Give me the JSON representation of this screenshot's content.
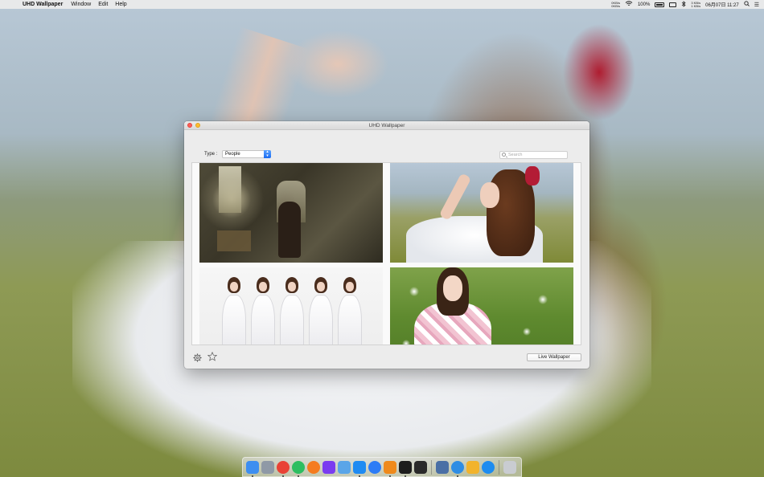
{
  "menubar": {
    "apple_symbol": "",
    "app_name": "UHD Wallpaper",
    "menus": [
      "Window",
      "Edit",
      "Help"
    ],
    "net_up": "0KB/s",
    "net_down": "0KB/s",
    "battery": "100%",
    "net_stat_up": "3 KB/s",
    "net_stat_down": "1 KB/s",
    "clock": "06月07日 11:27"
  },
  "window": {
    "title": "UHD Wallpaper",
    "type_label": "Type :",
    "type_value": "People",
    "search_placeholder": "Search",
    "live_wallpaper_label": "Live Wallpaper"
  },
  "gallery": {
    "thumbnails": [
      {
        "subject": "man-in-abandoned-room"
      },
      {
        "subject": "girl-with-red-bow-in-field"
      },
      {
        "subject": "group-in-white-dresses"
      },
      {
        "subject": "girl-in-kimono-with-flowers"
      }
    ]
  },
  "icons": {
    "settings": "gear-icon",
    "favorites": "star-icon",
    "search": "search-icon",
    "dropdown": "chevron-updown-icon"
  },
  "dock": {
    "apps": [
      {
        "name": "finder-icon",
        "color": "#3d8ef0"
      },
      {
        "name": "launchpad-icon",
        "color": "#8f99a6"
      },
      {
        "name": "chrome-icon",
        "color": "#e94235"
      },
      {
        "name": "evernote-icon",
        "color": "#2dbe60"
      },
      {
        "name": "books-icon",
        "color": "#f57c1f"
      },
      {
        "name": "istat-icon",
        "color": "#7a3cf0"
      },
      {
        "name": "preview-icon",
        "color": "#5aa5e8"
      },
      {
        "name": "xcode-icon",
        "color": "#1f8bf2"
      },
      {
        "name": "app-store-icon",
        "color": "#2d7cf6"
      },
      {
        "name": "sublime-icon",
        "color": "#ef8a1c"
      },
      {
        "name": "terminal-icon",
        "color": "#1d1d1d"
      },
      {
        "name": "activity-monitor-icon",
        "color": "#2a2a2a"
      },
      {
        "name": "downloads-icon",
        "color": "#4a6fa5"
      },
      {
        "name": "mweb-icon",
        "color": "#2f8de4"
      },
      {
        "name": "photos-icon",
        "color": "#f2b32c"
      },
      {
        "name": "safari-icon",
        "color": "#1d8cf0"
      },
      {
        "name": "trash-icon",
        "color": "#c9ccd1"
      }
    ]
  }
}
